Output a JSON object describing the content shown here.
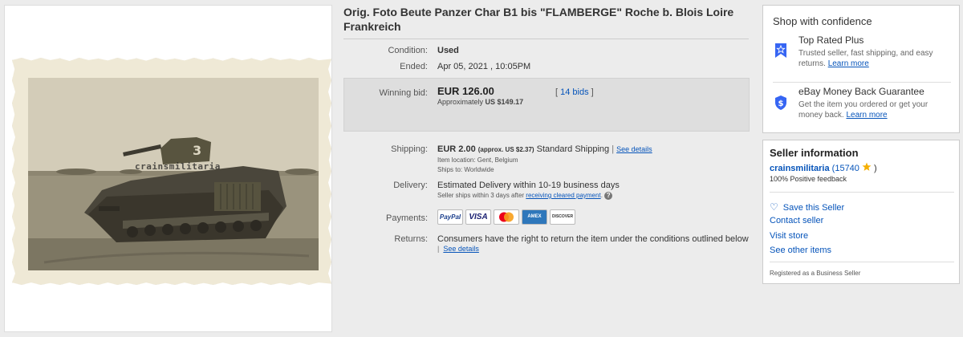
{
  "photo": {
    "watermark": "crainsmilitaria",
    "turret_number": "3"
  },
  "listing": {
    "title": "Orig. Foto Beute Panzer Char B1 bis \"FLAMBERGE\" Roche b. Blois Loire Frankreich"
  },
  "details": {
    "condition_label": "Condition:",
    "condition_value": "Used",
    "ended_label": "Ended:",
    "ended_value": "Apr 05, 2021 , 10:05PM",
    "winning_bid_label": "Winning bid:",
    "winning_bid_value": "EUR 126.00",
    "approx_prefix": "Approximately",
    "approx_value": "US $149.17",
    "bids_open": "[",
    "bids_link": "14 bids",
    "bids_close": "]",
    "shipping_label": "Shipping:",
    "shipping_cost": "EUR 2.00",
    "shipping_approx": "(approx. US $2.37)",
    "shipping_method": "Standard Shipping",
    "shipping_pipe": "|",
    "shipping_details_link": "See details",
    "item_location": "Item location:  Gent, Belgium",
    "ships_to": "Ships to:  Worldwide",
    "delivery_label": "Delivery:",
    "delivery_value": "Estimated Delivery within 10-19 business days",
    "delivery_note_prefix": "Seller ships within 3 days after",
    "delivery_note_link": "receiving cleared payment",
    "delivery_note_suffix": ".",
    "help_glyph": "?",
    "payments_label": "Payments:",
    "returns_label": "Returns:",
    "returns_value": "Consumers have the right to return the item under the conditions outlined below",
    "returns_pipe": "|",
    "returns_link": "See details"
  },
  "payments": {
    "paypal": "PayPal",
    "visa": "VISA",
    "amex": "AMEX",
    "discover": "DISCOVER"
  },
  "confidence": {
    "title": "Shop with confidence",
    "top_rated_title": "Top Rated Plus",
    "top_rated_text": "Trusted seller, fast shipping, and easy returns.",
    "top_rated_link": "Learn more",
    "guarantee_title": "eBay Money Back Guarantee",
    "guarantee_text": "Get the item you ordered or get your money back.",
    "guarantee_link": "Learn more"
  },
  "seller": {
    "title": "Seller information",
    "name": "crainsmilitaria",
    "score_open": "(",
    "score": "15740",
    "score_close": ")",
    "feedback": "100% Positive feedback",
    "save_seller": "Save this Seller",
    "contact": "Contact seller",
    "visit_store": "Visit store",
    "other_items": "See other items",
    "registered": "Registered as a Business Seller"
  },
  "colors": {
    "link": "#0654ba",
    "badge_blue": "#3665f3",
    "star": "#f5af02",
    "bid_box": "#dedede"
  },
  "icons": {
    "top_rated": "ribbon-star-icon",
    "guarantee": "shield-dollar-icon",
    "save": "heart-icon",
    "star": "star-icon"
  }
}
